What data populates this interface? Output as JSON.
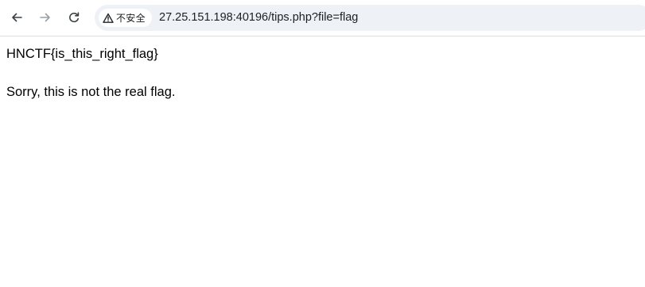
{
  "browser": {
    "security_label": "不安全",
    "url": "27.25.151.198:40196/tips.php?file=flag",
    "icons": {
      "back": "arrow-left-icon",
      "forward": "arrow-right-icon",
      "reload": "reload-icon",
      "security": "warning-triangle-icon"
    }
  },
  "page": {
    "flag_text": "HNCTF{is_this_right_flag}",
    "message": "Sorry, this is not the real flag."
  }
}
